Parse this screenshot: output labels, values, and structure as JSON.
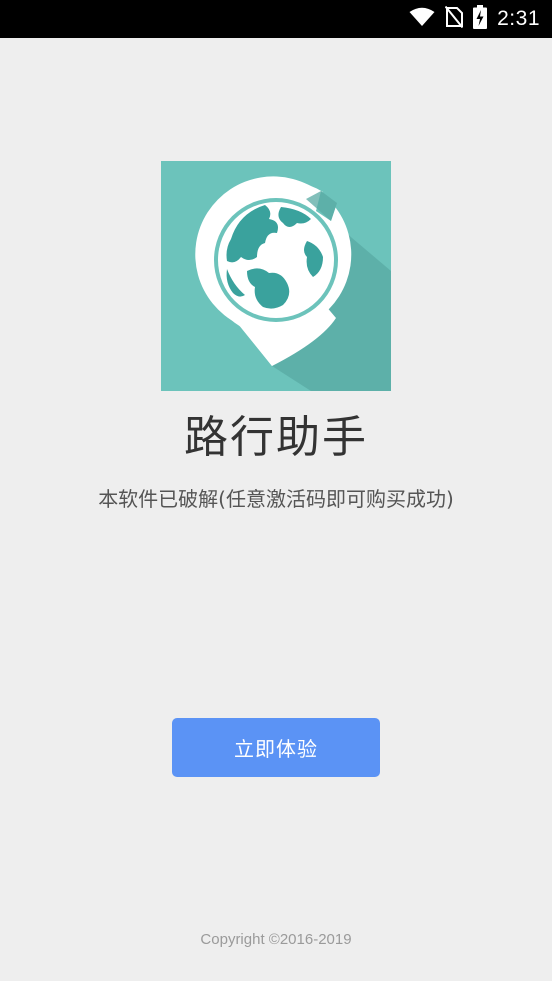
{
  "status_bar": {
    "time": "2:31",
    "icons": [
      "wifi-icon",
      "no-sim-icon",
      "battery-charging-icon"
    ]
  },
  "app": {
    "title": "路行助手",
    "subtitle": "本软件已破解(任意激活码即可购买成功)",
    "logo_icon": "globe-location-pin-icon",
    "colors": {
      "logo_background": "#6cc3bb",
      "globe_land": "#3aa29d",
      "button": "#5b93f5",
      "page_background": "#eeeeee"
    }
  },
  "actions": {
    "start_label": "立即体验"
  },
  "footer": {
    "copyright": "Copyright ©2016-2019"
  }
}
